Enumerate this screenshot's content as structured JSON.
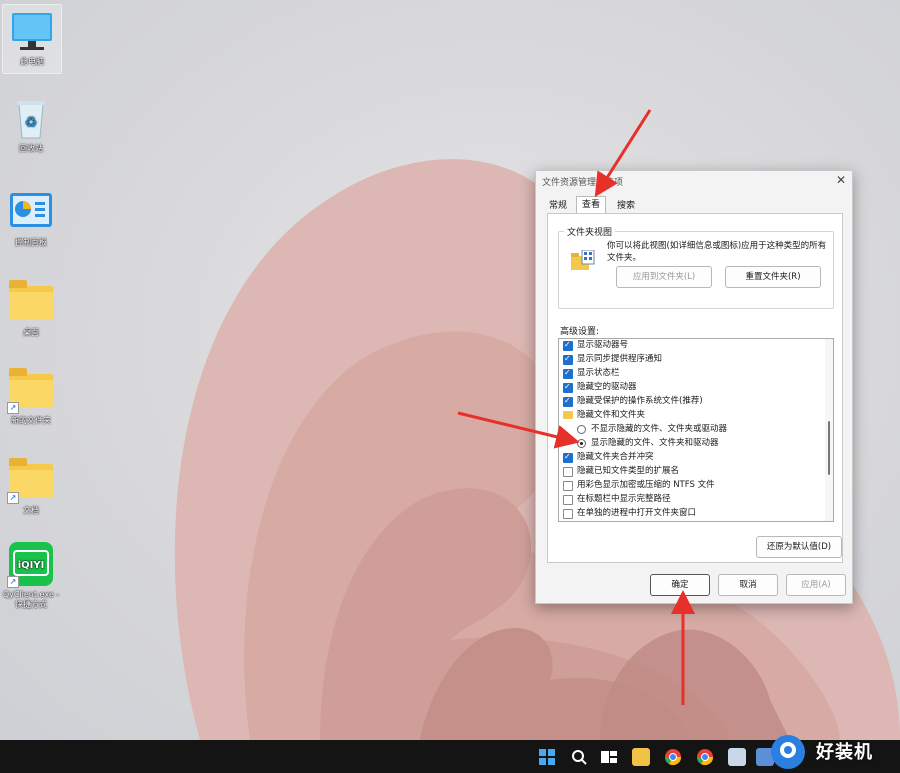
{
  "desktop": {
    "icons": [
      {
        "label": "此电脑",
        "icon": "computer-icon"
      },
      {
        "label": "回收站",
        "icon": "recycle-bin-icon"
      },
      {
        "label": "控制面板",
        "icon": "control-panel-icon"
      },
      {
        "label": "桌面",
        "icon": "folder-icon"
      },
      {
        "label": "新的文件夹",
        "icon": "folder-shortcut-icon"
      },
      {
        "label": "文档",
        "icon": "folder-shortcut-icon"
      },
      {
        "label": "QyClient.exe - 快捷方式",
        "icon": "iqiyi-icon",
        "brand_text": "iQIYI"
      }
    ]
  },
  "dialog": {
    "title": "文件资源管理器选项",
    "close_glyph": "✕",
    "tabs": [
      {
        "label": "常规",
        "active": false
      },
      {
        "label": "查看",
        "active": true
      },
      {
        "label": "搜索",
        "active": false
      }
    ],
    "folder_views": {
      "group_label": "文件夹视图",
      "description": "你可以将此视图(如详细信息或图标)应用于这种类型的所有文件夹。",
      "apply_button": "应用到文件夹(L)",
      "reset_button": "重置文件夹(R)"
    },
    "advanced": {
      "label": "高级设置:",
      "items": [
        {
          "type": "checkbox",
          "checked": true,
          "label": "显示驱动器号"
        },
        {
          "type": "checkbox",
          "checked": true,
          "label": "显示同步提供程序通知"
        },
        {
          "type": "checkbox",
          "checked": true,
          "label": "显示状态栏"
        },
        {
          "type": "checkbox",
          "checked": true,
          "label": "隐藏空的驱动器"
        },
        {
          "type": "checkbox",
          "checked": true,
          "label": "隐藏受保护的操作系统文件(推荐)"
        },
        {
          "type": "folder",
          "checked": false,
          "label": "隐藏文件和文件夹"
        },
        {
          "type": "radio",
          "checked": false,
          "label": "不显示隐藏的文件、文件夹或驱动器"
        },
        {
          "type": "radio",
          "checked": true,
          "label": "显示隐藏的文件、文件夹和驱动器"
        },
        {
          "type": "checkbox",
          "checked": true,
          "label": "隐藏文件夹合并冲突"
        },
        {
          "type": "checkbox",
          "checked": false,
          "label": "隐藏已知文件类型的扩展名"
        },
        {
          "type": "checkbox",
          "checked": false,
          "label": "用彩色显示加密或压缩的 NTFS 文件"
        },
        {
          "type": "checkbox",
          "checked": false,
          "label": "在标题栏中显示完整路径"
        },
        {
          "type": "checkbox",
          "checked": false,
          "label": "在单独的进程中打开文件夹窗口"
        }
      ]
    },
    "restore_defaults_button": "还原为默认值(D)",
    "ok_button": "确定",
    "cancel_button": "取消",
    "apply_button": "应用(A)"
  },
  "taskbar": {
    "icons": [
      "windows-start-icon",
      "search-icon",
      "task-view-icon",
      "file-explorer-icon",
      "chrome-icon",
      "chrome-icon",
      "app-icon",
      "app-icon"
    ]
  },
  "watermark": {
    "text": "好装机"
  },
  "colors": {
    "accent": "#1f6fcc",
    "arrow": "#e8302a",
    "taskbar": "#141414"
  }
}
